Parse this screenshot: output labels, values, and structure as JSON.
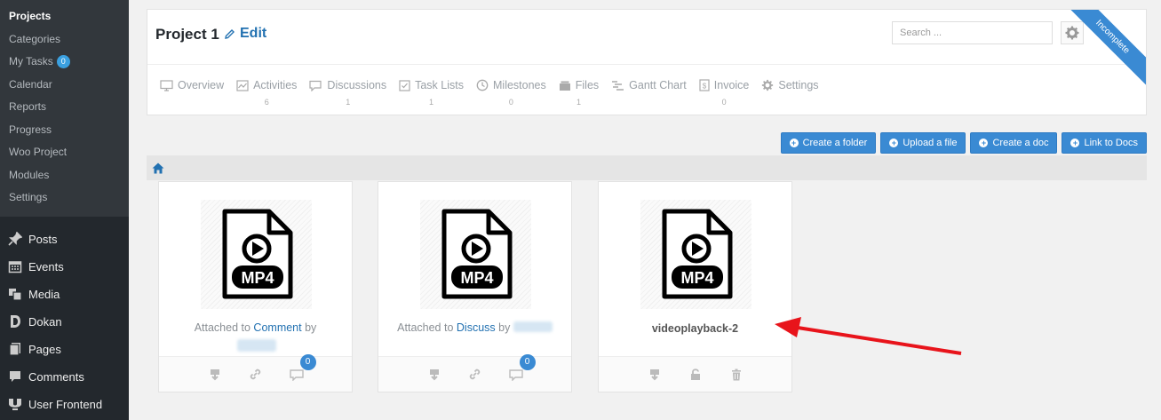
{
  "sidebar": {
    "submenu": [
      {
        "label": "Projects",
        "current": true
      },
      {
        "label": "Categories"
      },
      {
        "label": "My Tasks",
        "badge": "0"
      },
      {
        "label": "Calendar"
      },
      {
        "label": "Reports"
      },
      {
        "label": "Progress"
      },
      {
        "label": "Woo Project"
      },
      {
        "label": "Modules"
      },
      {
        "label": "Settings"
      }
    ],
    "menu": [
      {
        "label": "Posts",
        "icon": "pin-icon"
      },
      {
        "label": "Events",
        "icon": "calendar-icon"
      },
      {
        "label": "Media",
        "icon": "media-icon"
      },
      {
        "label": "Dokan",
        "icon": "dokan-icon"
      },
      {
        "label": "Pages",
        "icon": "pages-icon"
      },
      {
        "label": "Comments",
        "icon": "comment-icon"
      },
      {
        "label": "User Frontend",
        "icon": "user-frontend-icon"
      }
    ]
  },
  "header": {
    "project_title": "Project 1",
    "edit_label": "Edit",
    "search_placeholder": "Search ...",
    "ribbon": "Incomplete",
    "tabs": [
      {
        "label": "Overview",
        "count": ""
      },
      {
        "label": "Activities",
        "count": "6"
      },
      {
        "label": "Discussions",
        "count": "1"
      },
      {
        "label": "Task Lists",
        "count": "1"
      },
      {
        "label": "Milestones",
        "count": "0"
      },
      {
        "label": "Files",
        "count": "1"
      },
      {
        "label": "Gantt Chart",
        "count": ""
      },
      {
        "label": "Invoice",
        "count": "0"
      },
      {
        "label": "Settings",
        "count": ""
      }
    ]
  },
  "actions": {
    "create_folder": "Create a folder",
    "upload_file": "Upload a file",
    "create_doc": "Create a doc",
    "link_docs": "Link to Docs"
  },
  "files": [
    {
      "file_type": "MP4",
      "attached_prefix": "Attached to",
      "attached_link": "Comment",
      "by": "by",
      "comment_count": "0"
    },
    {
      "file_type": "MP4",
      "attached_prefix": "Attached to",
      "attached_link": "Discuss",
      "by": "by",
      "comment_count": "0"
    },
    {
      "file_type": "MP4",
      "name": "videoplayback-2"
    }
  ],
  "colors": {
    "accent": "#3a8ad3",
    "sidebar_bg": "#23282d",
    "arrow": "#e8141b"
  }
}
